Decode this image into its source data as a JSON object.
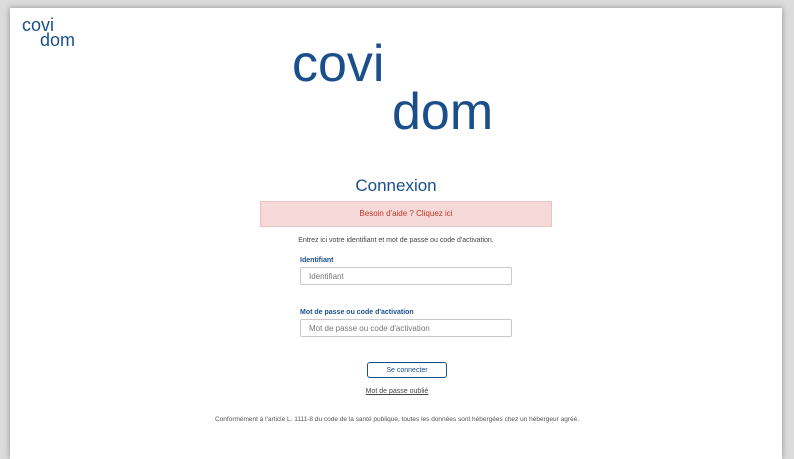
{
  "logo_small": {
    "line1": "covi",
    "line2": "dom"
  },
  "logo_big": {
    "line1": "covi",
    "line2": "dom"
  },
  "title": "Connexion",
  "help_banner": "Besoin d'aide ? Cliquez ici",
  "instructions": "Entrez ici votre identifiant et mot de passe ou code d'activation.",
  "identifiant": {
    "label": "Identifiant",
    "placeholder": "Identifiant"
  },
  "password": {
    "label": "Mot de passe ou code d'activation",
    "placeholder": "Mot de passe ou code d'activation"
  },
  "submit_label": "Se connecter",
  "forgot_label": "Mot de passe oublié",
  "footer": "Conformément à l'article L. 1111-8 du code de la santé publique, toutes les données sont hébergées chez un hébergeur agréé.",
  "colors": {
    "brand": "#1a4f8b",
    "alert_bg": "#f5d8d8",
    "alert_text": "#c0392b"
  }
}
